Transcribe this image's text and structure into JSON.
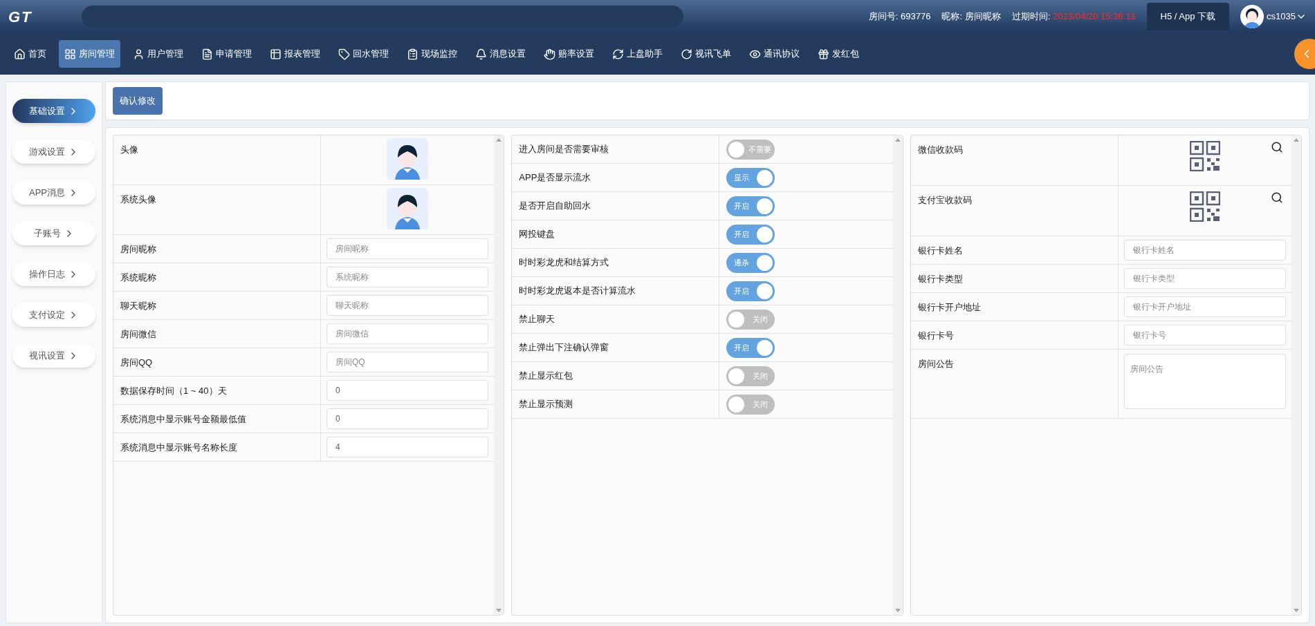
{
  "header": {
    "logo": "GT",
    "room_id": "房间号: 693776",
    "nickname": "昵称: 房间昵称",
    "expiry_label": "过期时间:",
    "expiry_value": "2023/04/20 15:36:13",
    "download_button": "H5 / App 下载",
    "user": "cs1035"
  },
  "nav": [
    {
      "label": "首页",
      "selected": false
    },
    {
      "label": "房间管理",
      "selected": true
    },
    {
      "label": "用户管理",
      "selected": false
    },
    {
      "label": "申请管理",
      "selected": false
    },
    {
      "label": "报表管理",
      "selected": false
    },
    {
      "label": "回水管理",
      "selected": false
    },
    {
      "label": "现场监控",
      "selected": false
    },
    {
      "label": "消息设置",
      "selected": false
    },
    {
      "label": "赔率设置",
      "selected": false
    },
    {
      "label": "上盘助手",
      "selected": false
    },
    {
      "label": "视讯飞单",
      "selected": false
    },
    {
      "label": "通讯协议",
      "selected": false
    },
    {
      "label": "发红包",
      "selected": false
    }
  ],
  "sidebar": [
    {
      "label": "基础设置",
      "selected": true
    },
    {
      "label": "游戏设置",
      "selected": false
    },
    {
      "label": "APP消息",
      "selected": false
    },
    {
      "label": "子账号",
      "selected": false
    },
    {
      "label": "操作日志",
      "selected": false
    },
    {
      "label": "支付设定",
      "selected": false
    },
    {
      "label": "视讯设置",
      "selected": false
    }
  ],
  "confirm_button": "确认修改",
  "profile_table": [
    {
      "kind": "avatar",
      "label": "头像"
    },
    {
      "kind": "avatar",
      "label": "系统头像"
    },
    {
      "kind": "input",
      "label": "房间昵称",
      "placeholder": "房间昵称"
    },
    {
      "kind": "input",
      "label": "系统昵称",
      "placeholder": "系统昵称"
    },
    {
      "kind": "input",
      "label": "聊天昵称",
      "placeholder": "聊天昵称"
    },
    {
      "kind": "input",
      "label": "房间微信",
      "placeholder": "房间微信"
    },
    {
      "kind": "input",
      "label": "房间QQ",
      "placeholder": "房间QQ"
    },
    {
      "kind": "input",
      "label": "数据保存时间（1 ~ 40）天",
      "value": "0"
    },
    {
      "kind": "input",
      "label": "系统消息中显示账号金额最低值",
      "value": "0"
    },
    {
      "kind": "input",
      "label": "系统消息中显示账号名称长度",
      "value": "4"
    }
  ],
  "switch_table": [
    {
      "label": "进入房间是否需要审核",
      "on": false,
      "text": "不需要"
    },
    {
      "label": "APP是否显示流水",
      "on": true,
      "text": "显示"
    },
    {
      "label": "是否开启自助回水",
      "on": true,
      "text": "开启"
    },
    {
      "label": "网投键盘",
      "on": true,
      "text": "开启"
    },
    {
      "label": "时时彩龙虎和结算方式",
      "on": true,
      "text": "通杀"
    },
    {
      "label": "时时彩龙虎返本是否计算流水",
      "on": true,
      "text": "开启"
    },
    {
      "label": "禁止聊天",
      "on": false,
      "text": "关闭"
    },
    {
      "label": "禁止弹出下注确认弹窗",
      "on": true,
      "text": "开启"
    },
    {
      "label": "禁止显示红包",
      "on": false,
      "text": "关闭"
    },
    {
      "label": "禁止显示预测",
      "on": false,
      "text": "关闭"
    }
  ],
  "payment_table": [
    {
      "kind": "qr",
      "label": "微信收款码"
    },
    {
      "kind": "qr",
      "label": "支付宝收款码"
    },
    {
      "kind": "input",
      "label": "银行卡姓名",
      "placeholder": "银行卡姓名"
    },
    {
      "kind": "input",
      "label": "银行卡类型",
      "placeholder": "银行卡类型"
    },
    {
      "kind": "input",
      "label": "银行卡开户地址",
      "placeholder": "银行卡开户地址"
    },
    {
      "kind": "input",
      "label": "银行卡号",
      "placeholder": "银行卡号"
    },
    {
      "kind": "textarea",
      "label": "房间公告",
      "placeholder": "房间公告"
    }
  ]
}
